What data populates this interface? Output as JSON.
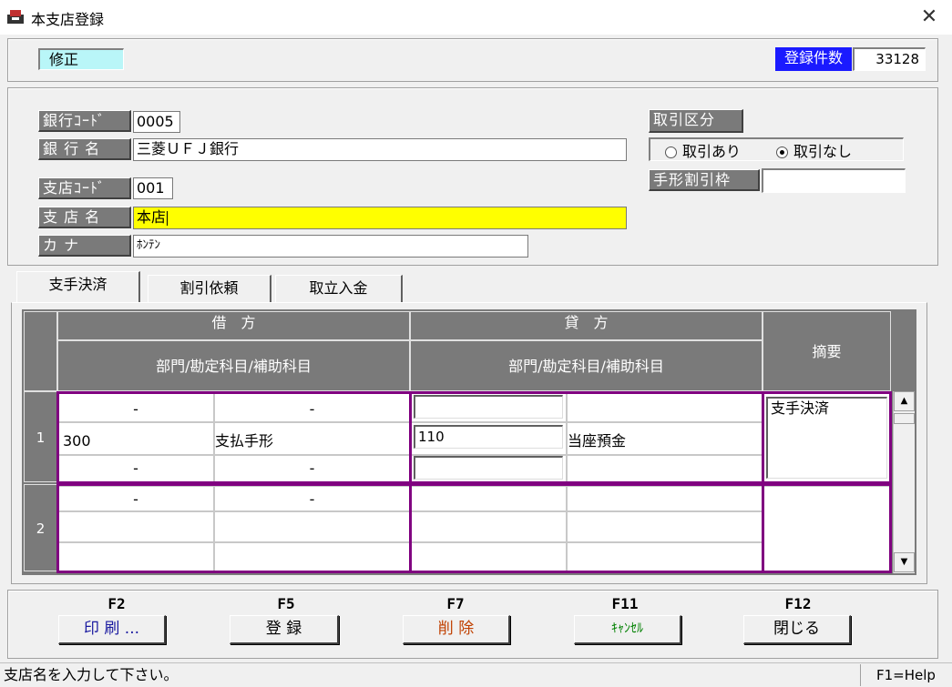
{
  "window": {
    "title": "本支店登録",
    "close_symbol": "✕"
  },
  "header": {
    "mode": "修正",
    "count_label": "登録件数",
    "count_value": "33128"
  },
  "form": {
    "bank_code_label": "銀行ｺｰﾄﾞ",
    "bank_code_value": "0005",
    "bank_name_label": "銀 行 名",
    "bank_name_value": "三菱ＵＦＪ銀行",
    "branch_code_label": "支店ｺｰﾄﾞ",
    "branch_code_value": "001",
    "branch_name_label": "支 店 名",
    "branch_name_value": "本店",
    "kana_label": "カ ナ",
    "kana_value": "ﾎﾝﾃﾝ",
    "transaction_label": "取引区分",
    "transaction_options": [
      "取引あり",
      "取引なし"
    ],
    "transaction_selected": "取引なし",
    "bill_discount_label": "手形割引枠",
    "bill_discount_value": ""
  },
  "tabs": [
    "支手決済",
    "割引依頼",
    "取立入金"
  ],
  "active_tab": "支手決済",
  "grid": {
    "debit_header": "借　方",
    "credit_header": "貸　方",
    "summary_header": "摘要",
    "sub_header": "部門/勘定科目/補助科目",
    "rows": [
      {
        "num": "1",
        "debit_top": [
          "-",
          "-"
        ],
        "debit_mid": [
          "300",
          "支払手形"
        ],
        "debit_bot": [
          "-",
          "-"
        ],
        "credit_top": [
          "",
          ""
        ],
        "credit_mid": [
          "110",
          "当座預金"
        ],
        "credit_bot": [
          "",
          ""
        ],
        "summary": "支手決済"
      },
      {
        "num": "2",
        "debit_top": [
          "-",
          "-"
        ],
        "debit_mid": [
          "",
          ""
        ],
        "debit_bot": [
          "",
          ""
        ],
        "summary": ""
      }
    ]
  },
  "function_keys": [
    {
      "key": "F2",
      "label": "印 刷 ...",
      "color": "#1a1aa0"
    },
    {
      "key": "F5",
      "label": "登 録",
      "color": "#000000"
    },
    {
      "key": "F7",
      "label": "削 除",
      "color": "#c04000"
    },
    {
      "key": "F11",
      "label": "ｷｬﾝｾﾙ",
      "color": "#008000"
    },
    {
      "key": "F12",
      "label": "閉じる",
      "color": "#000000"
    }
  ],
  "status": {
    "message": "支店名を入力して下さい。",
    "help": "F1=Help"
  }
}
